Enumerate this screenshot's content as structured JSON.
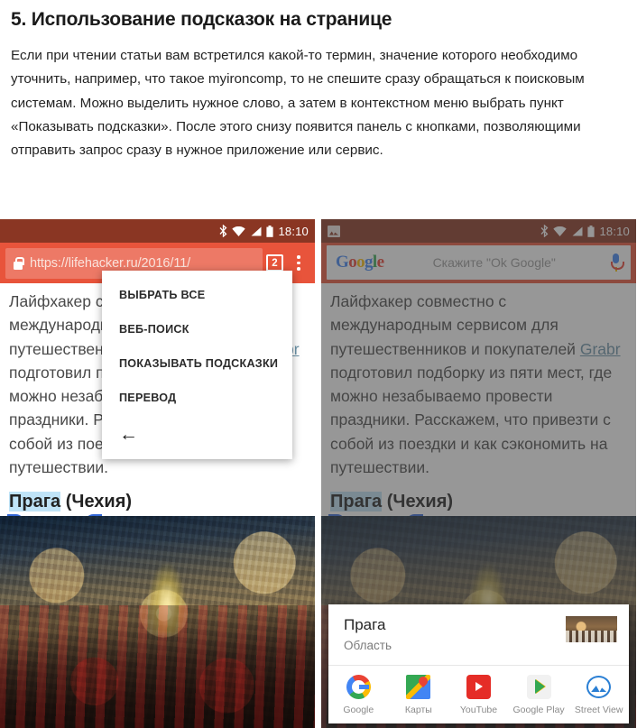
{
  "article": {
    "heading": "5. Использование подсказок на странице",
    "paragraph": "Если при чтении статьи вам встретился какой-то термин, значение которого необходимо уточнить, например, что такое myironcomp, то не спешите сразу обращаться к поисковым системам. Можно выделить нужное слово, а затем в контекстном меню выбрать пункт «Показывать подсказки». После этого снизу появится панель с кнопками, позволяющими отправить запрос сразу в нужное приложение или сервис."
  },
  "colors": {
    "statusbar": "#8a3623",
    "toolbar": "#e8543b",
    "selection": "#bfe3f7",
    "handle": "#3367d6",
    "link": "#6c93a8"
  },
  "left_phone": {
    "statusbar": {
      "clock": "18:10",
      "icons": [
        "bluetooth-icon",
        "wifi-icon",
        "signal-icon",
        "battery-icon"
      ]
    },
    "toolbar": {
      "lock_icon": "lock-icon",
      "url": "https://lifehacker.ru/2016/11/",
      "tab_count": "2",
      "overflow_icon": "kebab-menu-icon"
    },
    "webpage": {
      "paragraph_prefix": "Лайфхакер совместно с международным сервисом для путешественников и покупателей ",
      "link_text": "Grabr",
      "paragraph_suffix": " подготовил подборку из пяти мест, где можно незабываемо провести праздники. Расскажем, что привезти с собой из поездки и как сэкономить на путешествии.",
      "heading_selected": "Прага",
      "heading_rest": " (Чехия)"
    },
    "context_menu": {
      "items": [
        {
          "label": "ВЫБРАТЬ ВСЕ"
        },
        {
          "label": "ВЕБ-ПОИСК"
        },
        {
          "label": "ПОКАЗЫВАТЬ ПОДСКАЗКИ"
        },
        {
          "label": "ПЕРЕВОД"
        }
      ],
      "back_glyph": "←"
    }
  },
  "right_phone": {
    "statusbar": {
      "clock": "18:10",
      "notification_icon": "screenshot-image-icon",
      "icons": [
        "bluetooth-icon",
        "wifi-icon",
        "signal-icon",
        "battery-icon"
      ]
    },
    "search_bar": {
      "logo": "Google",
      "placeholder": "Скажите \"Ok Google\"",
      "mic_icon": "microphone-icon"
    },
    "webpage": {
      "paragraph_prefix": "Лайфхакер совместно с международным сервисом для путешественников и покупателей ",
      "link_text": "Grabr",
      "paragraph_suffix": " подготовил подборку из пяти мест, где можно незабываемо провести праздники. Расскажем, что привезти с собой из поездки и как сэкономить на путешествии.",
      "heading_selected": "Прага",
      "heading_rest": " (Чехия)"
    },
    "card": {
      "title": "Прага",
      "subtitle": "Область",
      "thumbnail": "prague-thumbnail",
      "apps": [
        {
          "label": "Google",
          "icon": "google-icon"
        },
        {
          "label": "Карты",
          "icon": "google-maps-icon"
        },
        {
          "label": "YouTube",
          "icon": "youtube-icon"
        },
        {
          "label": "Google Play",
          "icon": "google-play-icon"
        },
        {
          "label": "Street View",
          "icon": "street-view-icon"
        }
      ]
    }
  }
}
